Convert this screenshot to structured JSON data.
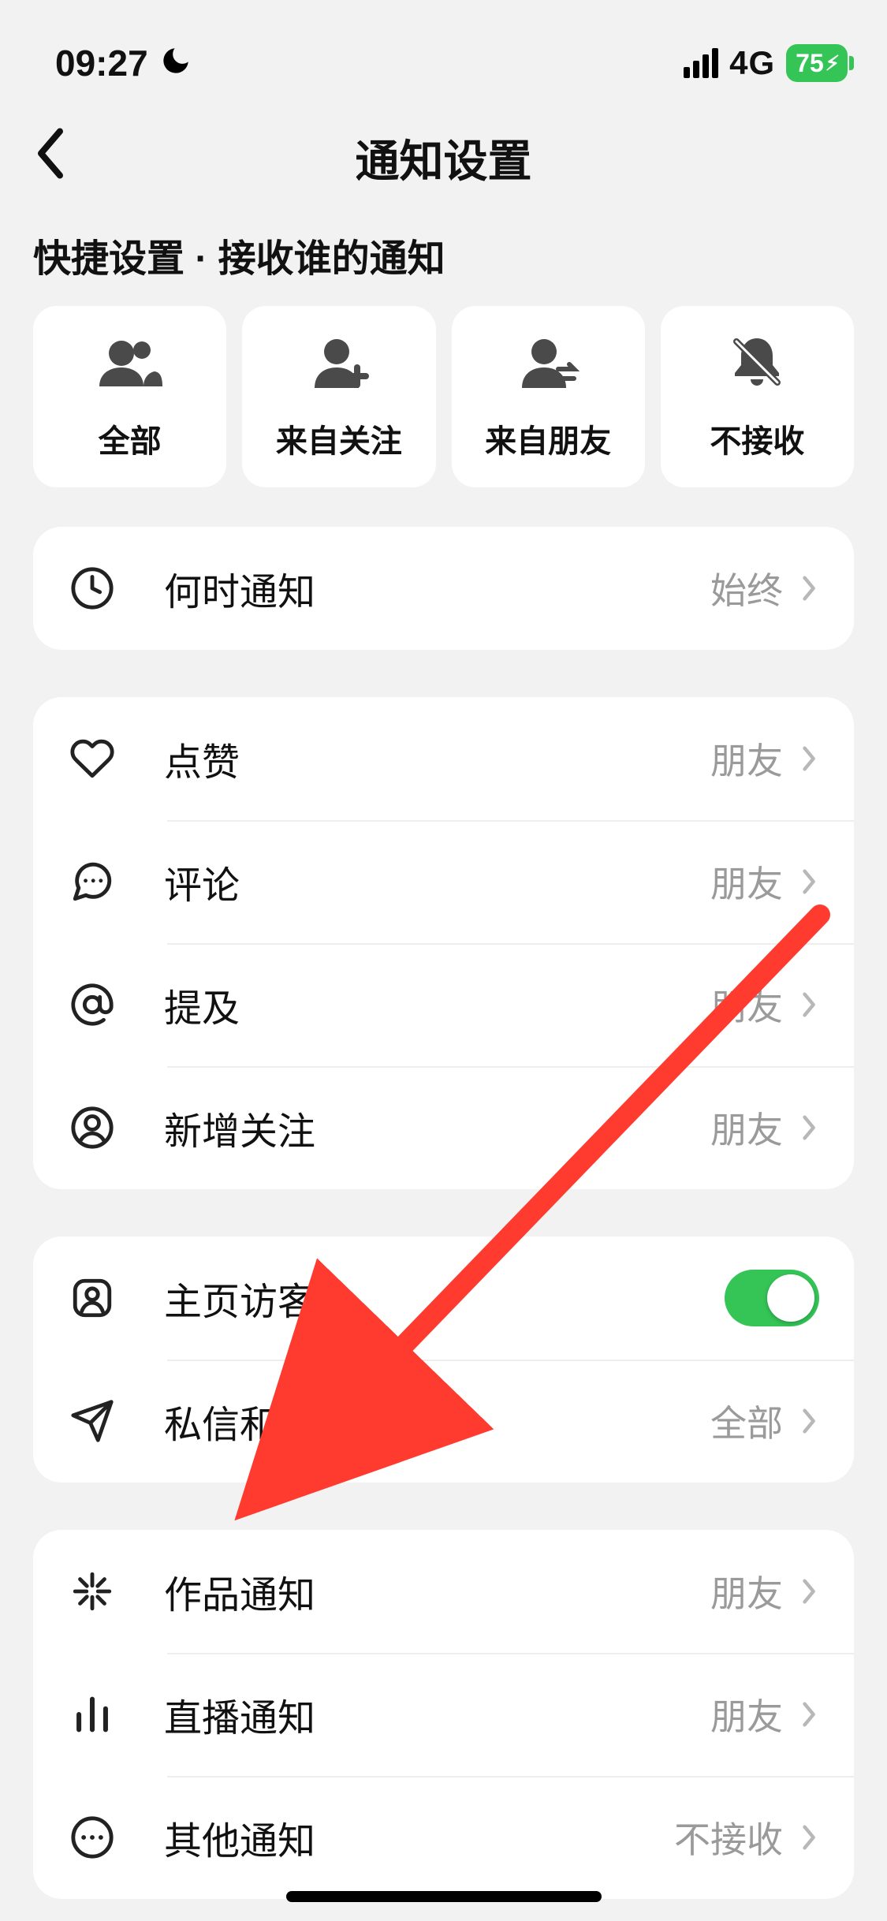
{
  "status": {
    "time": "09:27",
    "network": "4G",
    "battery": "75"
  },
  "header": {
    "title": "通知设置"
  },
  "section_heading": "快捷设置 · 接收谁的通知",
  "quick": {
    "items": [
      {
        "label": "全部",
        "icon": "people-icon"
      },
      {
        "label": "来自关注",
        "icon": "person-plus-icon"
      },
      {
        "label": "来自朋友",
        "icon": "person-swap-icon"
      },
      {
        "label": "不接收",
        "icon": "bell-off-icon"
      }
    ]
  },
  "group1": {
    "when_label": "何时通知",
    "when_value": "始终"
  },
  "group2": {
    "like": {
      "label": "点赞",
      "value": "朋友"
    },
    "comment": {
      "label": "评论",
      "value": "朋友"
    },
    "mention": {
      "label": "提及",
      "value": "朋友"
    },
    "follow": {
      "label": "新增关注",
      "value": "朋友"
    }
  },
  "group3": {
    "visitor": {
      "label": "主页访客",
      "toggle": true
    },
    "dm": {
      "label": "私信和通话",
      "value": "全部"
    }
  },
  "group4": {
    "works": {
      "label": "作品通知",
      "value": "朋友"
    },
    "live": {
      "label": "直播通知",
      "value": "朋友"
    },
    "other": {
      "label": "其他通知",
      "value": "不接收"
    }
  }
}
